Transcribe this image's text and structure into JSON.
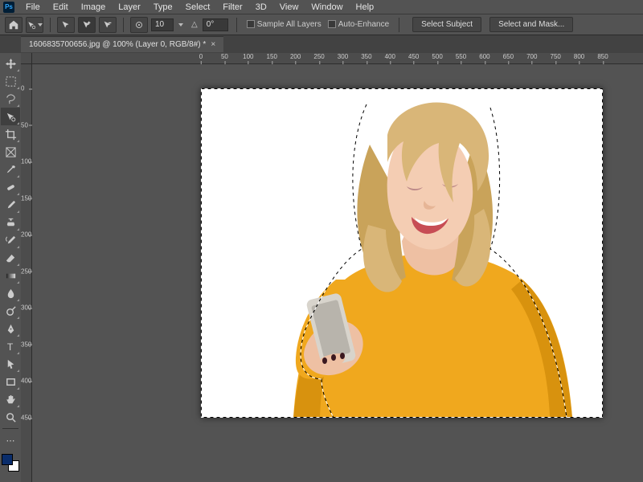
{
  "menubar": {
    "items": [
      "File",
      "Edit",
      "Image",
      "Layer",
      "Type",
      "Select",
      "Filter",
      "3D",
      "View",
      "Window",
      "Help"
    ]
  },
  "optbar": {
    "size": "10",
    "angle": "0°",
    "sample_all": "Sample All Layers",
    "auto_enhance": "Auto-Enhance",
    "select_subject": "Select Subject",
    "select_and_mask": "Select and Mask..."
  },
  "doc_tab": {
    "title": "1606835700656.jpg @ 100% (Layer 0, RGB/8#) *"
  },
  "ruler_h": [
    0,
    50,
    100,
    150,
    200,
    250,
    300,
    350,
    400,
    450,
    500,
    550,
    600,
    650,
    700,
    750,
    800,
    850
  ],
  "ruler_v": [
    0,
    50,
    100,
    150,
    200,
    250,
    300,
    350,
    400,
    450
  ]
}
